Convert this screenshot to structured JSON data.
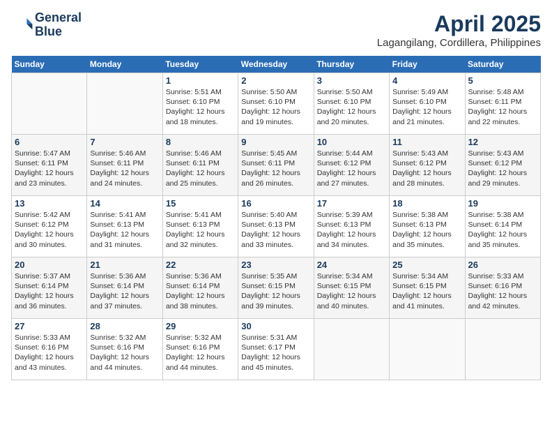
{
  "header": {
    "logo_line1": "General",
    "logo_line2": "Blue",
    "month_year": "April 2025",
    "location": "Lagangilang, Cordillera, Philippines"
  },
  "weekdays": [
    "Sunday",
    "Monday",
    "Tuesday",
    "Wednesday",
    "Thursday",
    "Friday",
    "Saturday"
  ],
  "weeks": [
    [
      {
        "day": "",
        "sunrise": "",
        "sunset": "",
        "daylight": ""
      },
      {
        "day": "",
        "sunrise": "",
        "sunset": "",
        "daylight": ""
      },
      {
        "day": "1",
        "sunrise": "Sunrise: 5:51 AM",
        "sunset": "Sunset: 6:10 PM",
        "daylight": "Daylight: 12 hours and 18 minutes."
      },
      {
        "day": "2",
        "sunrise": "Sunrise: 5:50 AM",
        "sunset": "Sunset: 6:10 PM",
        "daylight": "Daylight: 12 hours and 19 minutes."
      },
      {
        "day": "3",
        "sunrise": "Sunrise: 5:50 AM",
        "sunset": "Sunset: 6:10 PM",
        "daylight": "Daylight: 12 hours and 20 minutes."
      },
      {
        "day": "4",
        "sunrise": "Sunrise: 5:49 AM",
        "sunset": "Sunset: 6:10 PM",
        "daylight": "Daylight: 12 hours and 21 minutes."
      },
      {
        "day": "5",
        "sunrise": "Sunrise: 5:48 AM",
        "sunset": "Sunset: 6:11 PM",
        "daylight": "Daylight: 12 hours and 22 minutes."
      }
    ],
    [
      {
        "day": "6",
        "sunrise": "Sunrise: 5:47 AM",
        "sunset": "Sunset: 6:11 PM",
        "daylight": "Daylight: 12 hours and 23 minutes."
      },
      {
        "day": "7",
        "sunrise": "Sunrise: 5:46 AM",
        "sunset": "Sunset: 6:11 PM",
        "daylight": "Daylight: 12 hours and 24 minutes."
      },
      {
        "day": "8",
        "sunrise": "Sunrise: 5:46 AM",
        "sunset": "Sunset: 6:11 PM",
        "daylight": "Daylight: 12 hours and 25 minutes."
      },
      {
        "day": "9",
        "sunrise": "Sunrise: 5:45 AM",
        "sunset": "Sunset: 6:11 PM",
        "daylight": "Daylight: 12 hours and 26 minutes."
      },
      {
        "day": "10",
        "sunrise": "Sunrise: 5:44 AM",
        "sunset": "Sunset: 6:12 PM",
        "daylight": "Daylight: 12 hours and 27 minutes."
      },
      {
        "day": "11",
        "sunrise": "Sunrise: 5:43 AM",
        "sunset": "Sunset: 6:12 PM",
        "daylight": "Daylight: 12 hours and 28 minutes."
      },
      {
        "day": "12",
        "sunrise": "Sunrise: 5:43 AM",
        "sunset": "Sunset: 6:12 PM",
        "daylight": "Daylight: 12 hours and 29 minutes."
      }
    ],
    [
      {
        "day": "13",
        "sunrise": "Sunrise: 5:42 AM",
        "sunset": "Sunset: 6:12 PM",
        "daylight": "Daylight: 12 hours and 30 minutes."
      },
      {
        "day": "14",
        "sunrise": "Sunrise: 5:41 AM",
        "sunset": "Sunset: 6:13 PM",
        "daylight": "Daylight: 12 hours and 31 minutes."
      },
      {
        "day": "15",
        "sunrise": "Sunrise: 5:41 AM",
        "sunset": "Sunset: 6:13 PM",
        "daylight": "Daylight: 12 hours and 32 minutes."
      },
      {
        "day": "16",
        "sunrise": "Sunrise: 5:40 AM",
        "sunset": "Sunset: 6:13 PM",
        "daylight": "Daylight: 12 hours and 33 minutes."
      },
      {
        "day": "17",
        "sunrise": "Sunrise: 5:39 AM",
        "sunset": "Sunset: 6:13 PM",
        "daylight": "Daylight: 12 hours and 34 minutes."
      },
      {
        "day": "18",
        "sunrise": "Sunrise: 5:38 AM",
        "sunset": "Sunset: 6:13 PM",
        "daylight": "Daylight: 12 hours and 35 minutes."
      },
      {
        "day": "19",
        "sunrise": "Sunrise: 5:38 AM",
        "sunset": "Sunset: 6:14 PM",
        "daylight": "Daylight: 12 hours and 35 minutes."
      }
    ],
    [
      {
        "day": "20",
        "sunrise": "Sunrise: 5:37 AM",
        "sunset": "Sunset: 6:14 PM",
        "daylight": "Daylight: 12 hours and 36 minutes."
      },
      {
        "day": "21",
        "sunrise": "Sunrise: 5:36 AM",
        "sunset": "Sunset: 6:14 PM",
        "daylight": "Daylight: 12 hours and 37 minutes."
      },
      {
        "day": "22",
        "sunrise": "Sunrise: 5:36 AM",
        "sunset": "Sunset: 6:14 PM",
        "daylight": "Daylight: 12 hours and 38 minutes."
      },
      {
        "day": "23",
        "sunrise": "Sunrise: 5:35 AM",
        "sunset": "Sunset: 6:15 PM",
        "daylight": "Daylight: 12 hours and 39 minutes."
      },
      {
        "day": "24",
        "sunrise": "Sunrise: 5:34 AM",
        "sunset": "Sunset: 6:15 PM",
        "daylight": "Daylight: 12 hours and 40 minutes."
      },
      {
        "day": "25",
        "sunrise": "Sunrise: 5:34 AM",
        "sunset": "Sunset: 6:15 PM",
        "daylight": "Daylight: 12 hours and 41 minutes."
      },
      {
        "day": "26",
        "sunrise": "Sunrise: 5:33 AM",
        "sunset": "Sunset: 6:16 PM",
        "daylight": "Daylight: 12 hours and 42 minutes."
      }
    ],
    [
      {
        "day": "27",
        "sunrise": "Sunrise: 5:33 AM",
        "sunset": "Sunset: 6:16 PM",
        "daylight": "Daylight: 12 hours and 43 minutes."
      },
      {
        "day": "28",
        "sunrise": "Sunrise: 5:32 AM",
        "sunset": "Sunset: 6:16 PM",
        "daylight": "Daylight: 12 hours and 44 minutes."
      },
      {
        "day": "29",
        "sunrise": "Sunrise: 5:32 AM",
        "sunset": "Sunset: 6:16 PM",
        "daylight": "Daylight: 12 hours and 44 minutes."
      },
      {
        "day": "30",
        "sunrise": "Sunrise: 5:31 AM",
        "sunset": "Sunset: 6:17 PM",
        "daylight": "Daylight: 12 hours and 45 minutes."
      },
      {
        "day": "",
        "sunrise": "",
        "sunset": "",
        "daylight": ""
      },
      {
        "day": "",
        "sunrise": "",
        "sunset": "",
        "daylight": ""
      },
      {
        "day": "",
        "sunrise": "",
        "sunset": "",
        "daylight": ""
      }
    ]
  ]
}
